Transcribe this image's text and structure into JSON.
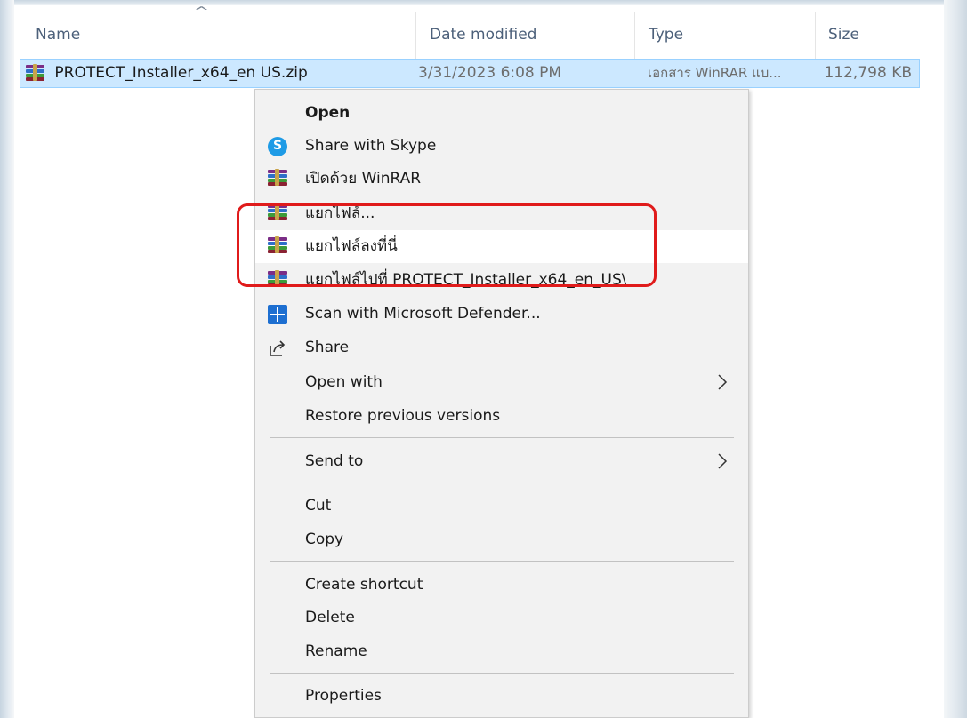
{
  "columns": {
    "name": "Name",
    "date_modified": "Date modified",
    "type": "Type",
    "size": "Size"
  },
  "sort_indicator": "^",
  "file": {
    "name": "PROTECT_Installer_x64_en US.zip",
    "date": "3/31/2023 6:08 PM",
    "type": "เอกสาร WinRAR แบ...",
    "size": "112,798 KB",
    "icon": "winrar-archive-icon"
  },
  "context_menu": {
    "open": "Open",
    "share_skype": "Share with Skype",
    "open_winrar": "เปิดด้วย WinRAR",
    "extract_files": "แยกไฟล์...",
    "extract_here": "แยกไฟล์ลงที่นี่",
    "extract_to": "แยกไฟล์ไปที่ PROTECT_Installer_x64_en_US\\",
    "scan_defender": "Scan with Microsoft Defender...",
    "share": "Share",
    "open_with": "Open with",
    "restore_versions": "Restore previous versions",
    "send_to": "Send to",
    "cut": "Cut",
    "copy": "Copy",
    "create_shortcut": "Create shortcut",
    "delete": "Delete",
    "rename": "Rename",
    "properties": "Properties"
  },
  "colors": {
    "selection": "#cce8ff",
    "menu_bg": "#f2f2f2",
    "highlight_annotation": "#e01b1b"
  }
}
